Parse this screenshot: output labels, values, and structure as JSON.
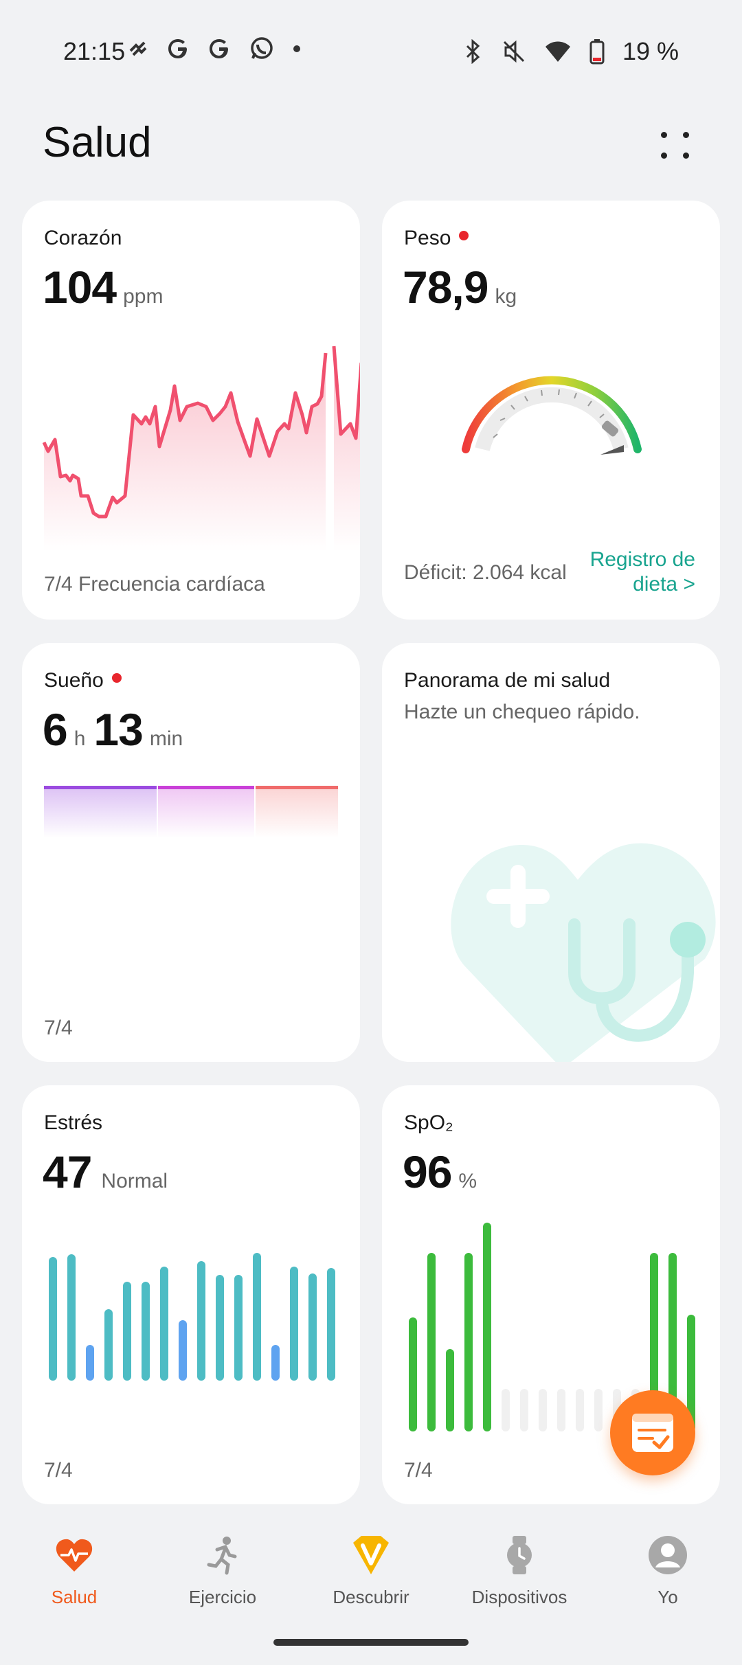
{
  "status_bar": {
    "time": "21:15",
    "battery_percent": "19 %",
    "left_icons": [
      "signal-slash-icon",
      "google-icon",
      "google-icon",
      "whatsapp-icon",
      "dot-icon"
    ],
    "right_icons": [
      "bluetooth-icon",
      "vibrate-off-icon",
      "wifi-icon",
      "battery-icon"
    ]
  },
  "header": {
    "title": "Salud",
    "more_icon": "more-dots-icon"
  },
  "cards": {
    "heart": {
      "title": "Corazón",
      "value": "104",
      "unit": "ppm",
      "footer": "7/4 Frecuencia cardíaca",
      "color": "#f0506e"
    },
    "weight": {
      "title": "Peso",
      "value": "78,9",
      "unit": "kg",
      "footer": "Déficit: 2.064 kcal",
      "link_line1": "Registro de",
      "link_line2": "dieta",
      "link_arrow": ">"
    },
    "sleep": {
      "title": "Sueño",
      "hours": "6",
      "hours_unit": "h",
      "minutes": "13",
      "minutes_unit": "min",
      "footer": "7/4",
      "stage_colors": [
        "#9b4be0",
        "#c940d8",
        "#f06b6b"
      ]
    },
    "overview": {
      "title": "Panorama de mi salud",
      "subtitle": "Hazte un chequeo rápido."
    },
    "stress": {
      "title": "Estrés",
      "value": "47",
      "unit": "Normal",
      "footer": "7/4",
      "color_normal": "#4dbcc4",
      "color_relaxed": "#5ea3f0"
    },
    "spo2": {
      "title": "SpO₂",
      "value": "96",
      "unit": "%",
      "footer": "7/4",
      "color": "#3cbb3c"
    }
  },
  "bottom_nav": {
    "items": [
      {
        "label": "Salud",
        "icon": "heart-pulse-icon",
        "active": true
      },
      {
        "label": "Ejercicio",
        "icon": "running-icon",
        "active": false
      },
      {
        "label": "Descubrir",
        "icon": "discover-v-icon",
        "active": false
      },
      {
        "label": "Dispositivos",
        "icon": "watch-icon",
        "active": false
      },
      {
        "label": "Yo",
        "icon": "profile-icon",
        "active": false
      }
    ]
  },
  "fab": {
    "icon": "diet-log-icon"
  }
}
